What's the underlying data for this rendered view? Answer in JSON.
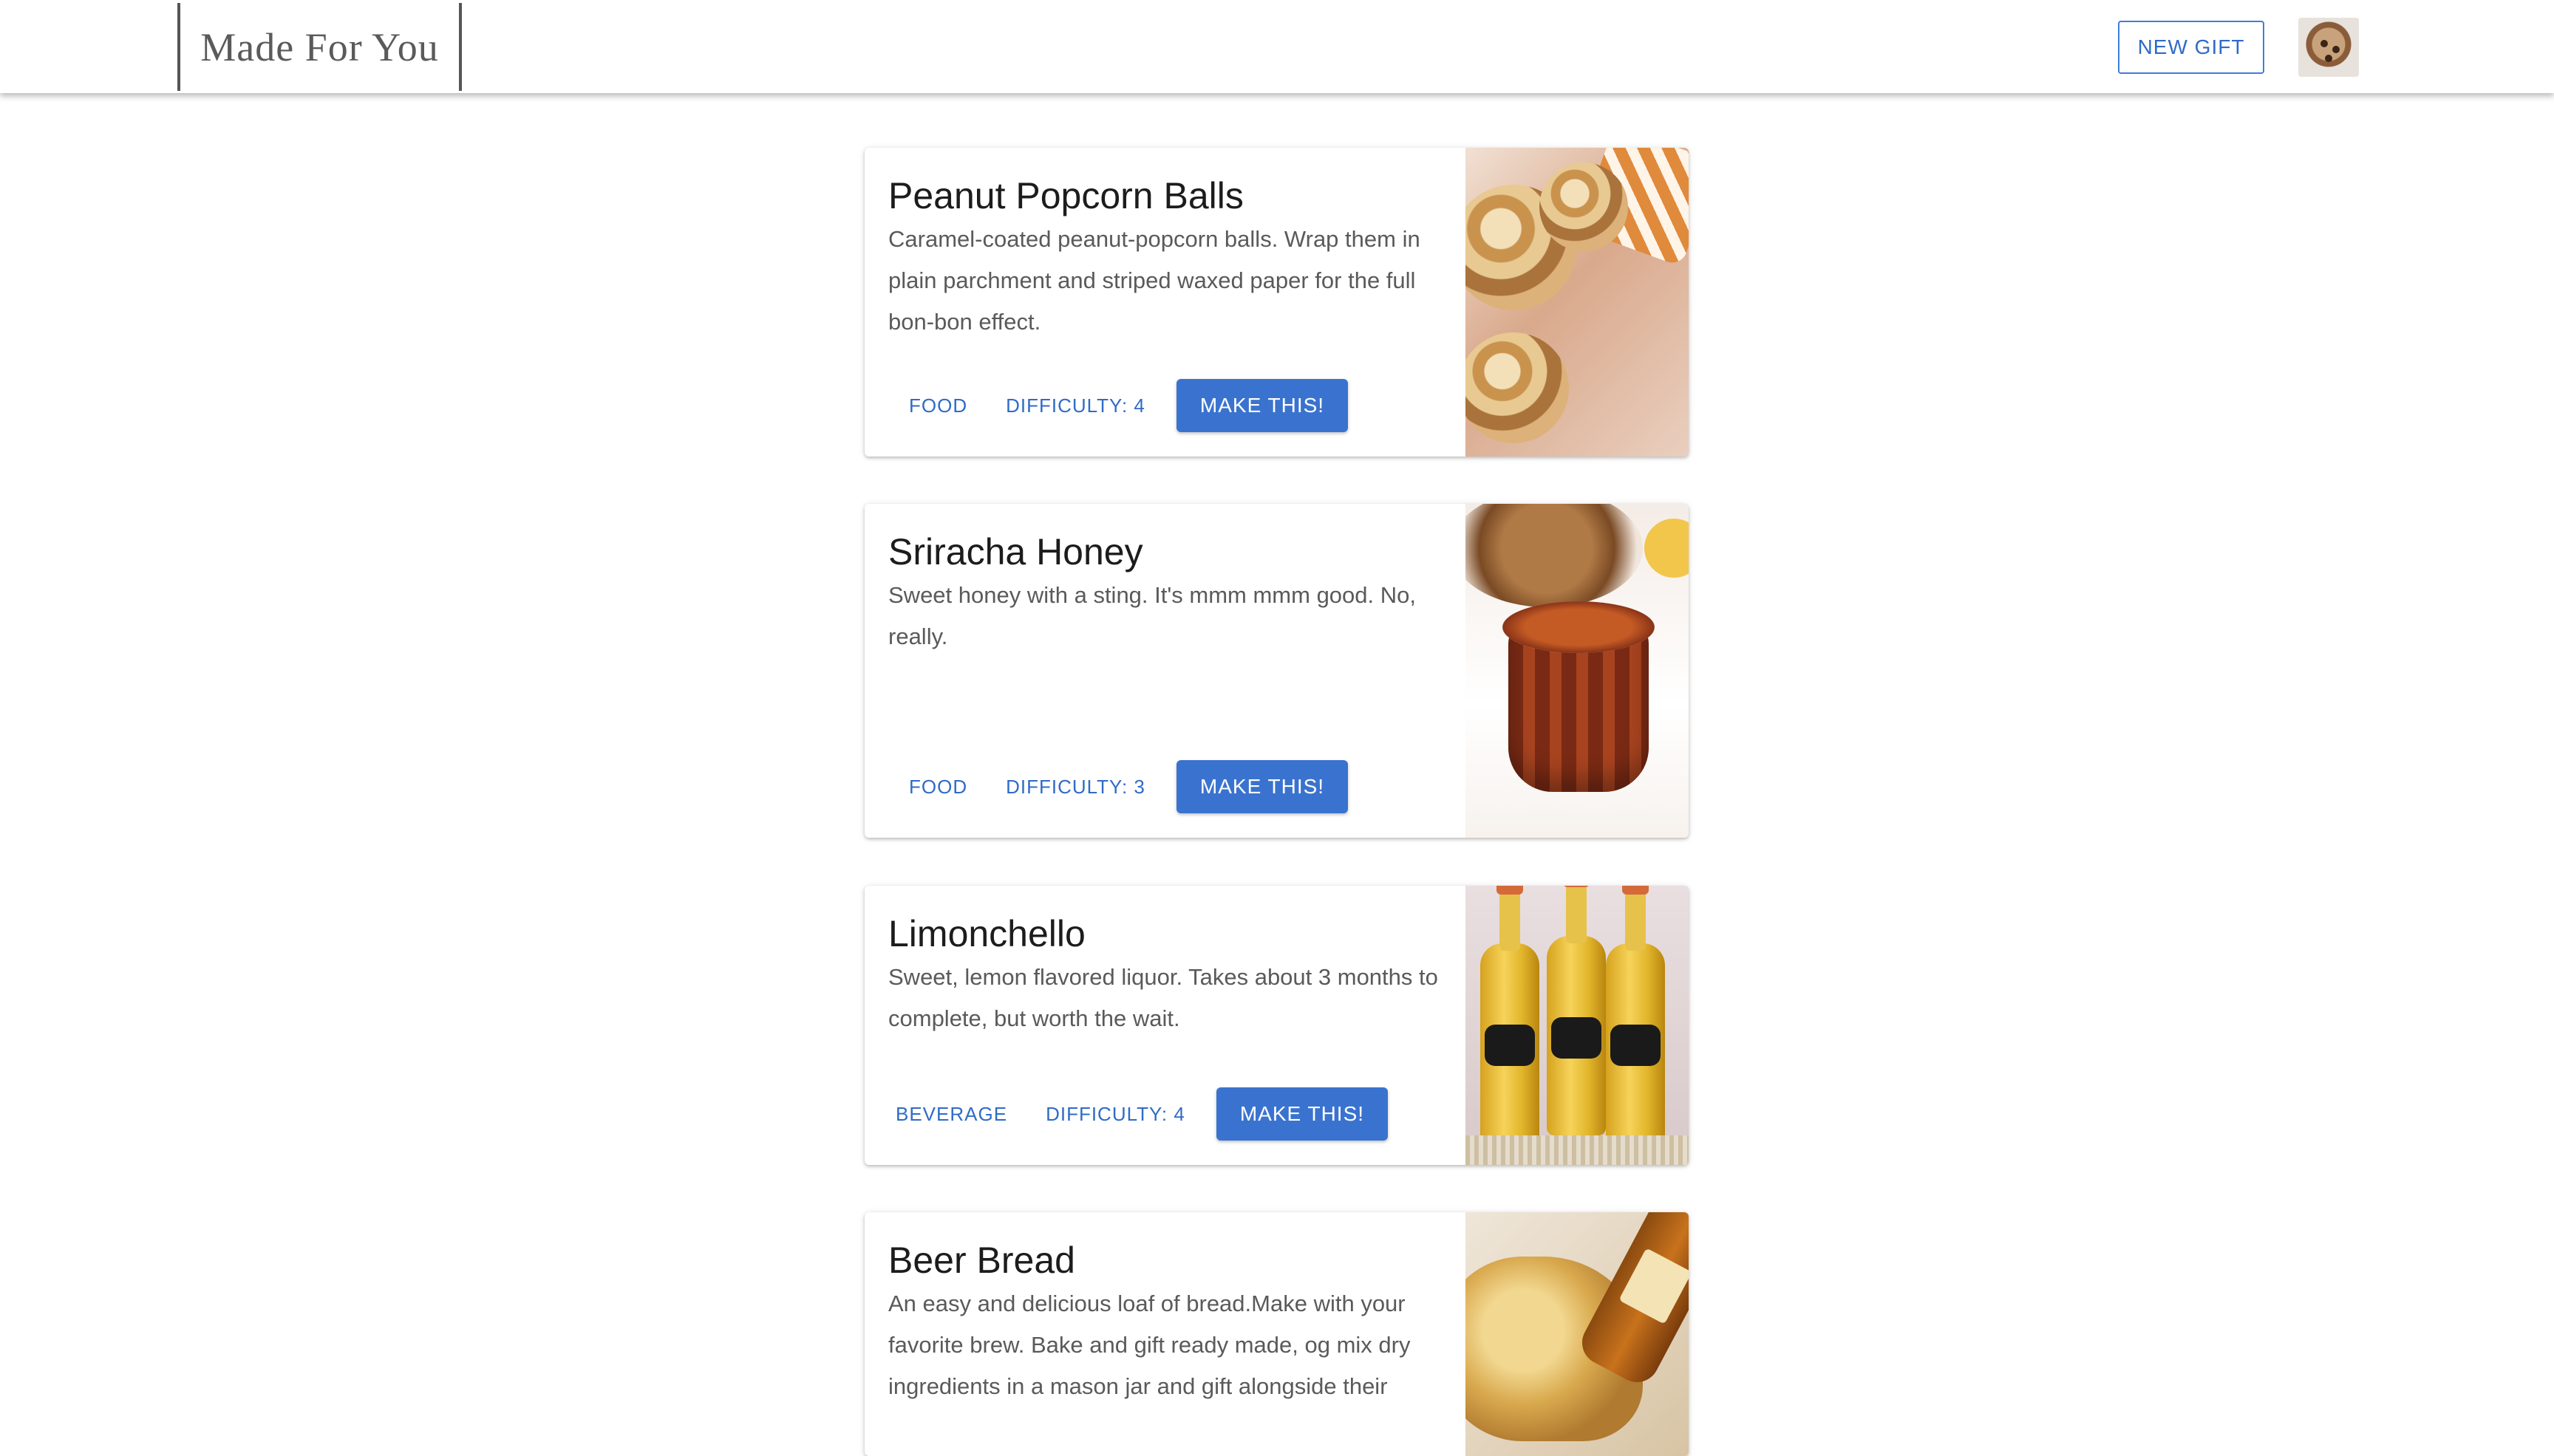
{
  "header": {
    "brand": "Made For You",
    "new_gift_label": "NEW GIFT"
  },
  "cards": [
    {
      "title": "Peanut Popcorn Balls",
      "description": "Caramel-coated peanut-popcorn balls. Wrap them in plain parchment and striped waxed paper for the full bon-bon effect.",
      "category": "FOOD",
      "difficulty": "DIFFICULTY: 4",
      "button": "MAKE THIS!",
      "image_icon": "popcorn-balls-photo"
    },
    {
      "title": "Sriracha Honey",
      "description": "Sweet honey with a sting. It's mmm mmm good. No, really.",
      "category": "FOOD",
      "difficulty": "DIFFICULTY: 3",
      "button": "MAKE THIS!",
      "image_icon": "honey-jar-photo"
    },
    {
      "title": "Limonchello",
      "description": "Sweet, lemon flavored liquor. Takes about 3 months to complete, but worth the wait.",
      "category": "BEVERAGE",
      "difficulty": "DIFFICULTY: 4",
      "button": "MAKE THIS!",
      "image_icon": "limoncello-bottles-photo"
    },
    {
      "title": "Beer Bread",
      "description": "An easy and delicious loaf of bread.Make with your favorite brew. Bake and gift ready made, og mix dry ingredients in a mason jar and gift alongside their",
      "image_icon": "beer-bread-photo"
    }
  ],
  "colors": {
    "accent": "#3a73cf",
    "accent_text": "#2f6bc7",
    "title_text": "#1c1c1c",
    "body_text": "#5a5a5a"
  }
}
